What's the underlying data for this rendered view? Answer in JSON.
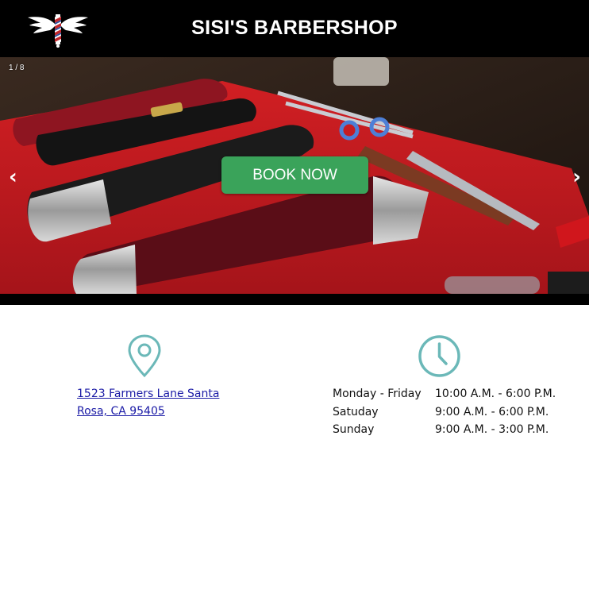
{
  "header": {
    "title": "SISI'S BARBERSHOP",
    "logo_icon": "winged-barber-pole-icon"
  },
  "slideshow": {
    "counter": "1 / 8",
    "book_label": "BOOK NOW",
    "prev_icon": "chevron-left-icon",
    "next_icon": "chevron-right-icon",
    "image_subject": "barber clippers on red mat"
  },
  "location": {
    "icon": "map-pin-icon",
    "address": "1523 Farmers Lane Santa Rosa, CA 95405"
  },
  "hours": {
    "icon": "clock-icon",
    "rows": [
      {
        "day": "Monday - Friday",
        "time": "10:00 A.M. - 6:00 P.M."
      },
      {
        "day": "Satuday",
        "time": "9:00 A.M. - 6:00 P.M."
      },
      {
        "day": "Sunday",
        "time": "9:00 A.M. - 3:00 P.M."
      }
    ]
  },
  "colors": {
    "accent_green": "#3aa35a",
    "icon_teal": "#6bb8b8",
    "header_bg": "#000000",
    "link_blue": "#1a1aa6"
  }
}
